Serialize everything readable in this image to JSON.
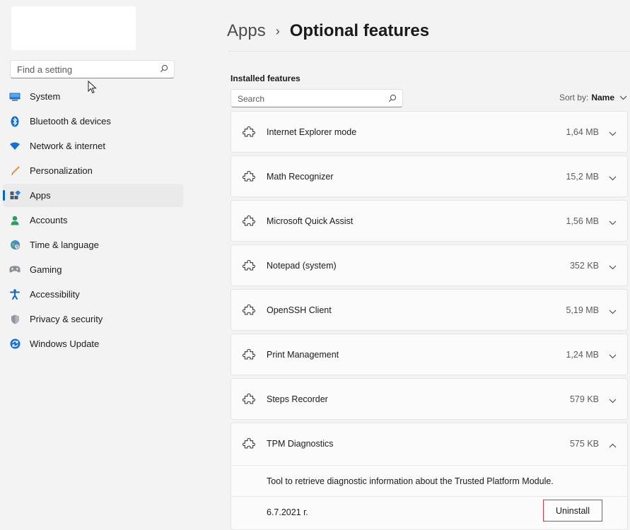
{
  "sidebar": {
    "search_placeholder": "Find a setting",
    "items": [
      {
        "label": "System",
        "icon": "monitor-icon"
      },
      {
        "label": "Bluetooth & devices",
        "icon": "bluetooth-icon"
      },
      {
        "label": "Network & internet",
        "icon": "wifi-icon"
      },
      {
        "label": "Personalization",
        "icon": "brush-icon"
      },
      {
        "label": "Apps",
        "icon": "apps-icon",
        "active": true
      },
      {
        "label": "Accounts",
        "icon": "person-icon"
      },
      {
        "label": "Time & language",
        "icon": "globe-clock-icon"
      },
      {
        "label": "Gaming",
        "icon": "gamepad-icon"
      },
      {
        "label": "Accessibility",
        "icon": "accessibility-icon"
      },
      {
        "label": "Privacy & security",
        "icon": "shield-icon"
      },
      {
        "label": "Windows Update",
        "icon": "update-icon"
      }
    ]
  },
  "header": {
    "parent": "Apps",
    "separator": "›",
    "current": "Optional features"
  },
  "installed": {
    "title": "Installed features",
    "search_placeholder": "Search",
    "sort_label": "Sort by:",
    "sort_value": "Name",
    "features": [
      {
        "name": "Internet Explorer mode",
        "size": "1,64 MB"
      },
      {
        "name": "Math Recognizer",
        "size": "15,2 MB"
      },
      {
        "name": "Microsoft Quick Assist",
        "size": "1,56 MB"
      },
      {
        "name": "Notepad (system)",
        "size": "352 KB"
      },
      {
        "name": "OpenSSH Client",
        "size": "5,19 MB"
      },
      {
        "name": "Print Management",
        "size": "1,24 MB"
      },
      {
        "name": "Steps Recorder",
        "size": "579 KB"
      }
    ],
    "expanded": {
      "name": "TPM Diagnostics",
      "size": "575 KB",
      "description": "Tool to retrieve diagnostic information about the Trusted Platform Module.",
      "date": "6.7.2021 г.",
      "uninstall_label": "Uninstall"
    }
  },
  "colors": {
    "accent": "#0067c0",
    "highlight_border": "#d9363e"
  }
}
